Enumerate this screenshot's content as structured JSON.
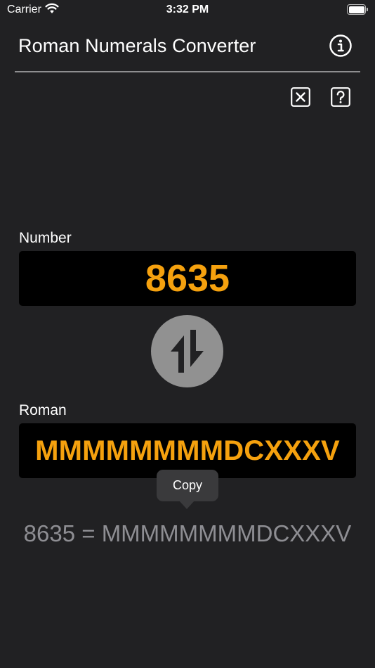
{
  "status_bar": {
    "carrier": "Carrier",
    "time": "3:32 PM"
  },
  "header": {
    "title": "Roman Numerals Converter",
    "info_icon": "info-circle-icon"
  },
  "toolbar": {
    "clear_icon": "clear-box-icon",
    "help_icon": "help-box-icon"
  },
  "number": {
    "label": "Number",
    "value": "8635"
  },
  "swap_icon": "swap-arrows-icon",
  "roman": {
    "label": "Roman",
    "value": "MMMMMMMMDCXXXV"
  },
  "menu": {
    "copy_label": "Copy"
  },
  "result": {
    "text": "8635 = MMMMMMMMDCXXXV"
  },
  "colors": {
    "background": "#212123",
    "accent": "#f5a10e",
    "field_background": "#000000",
    "swap_button": "#919191",
    "result_text": "#8e8e93"
  }
}
